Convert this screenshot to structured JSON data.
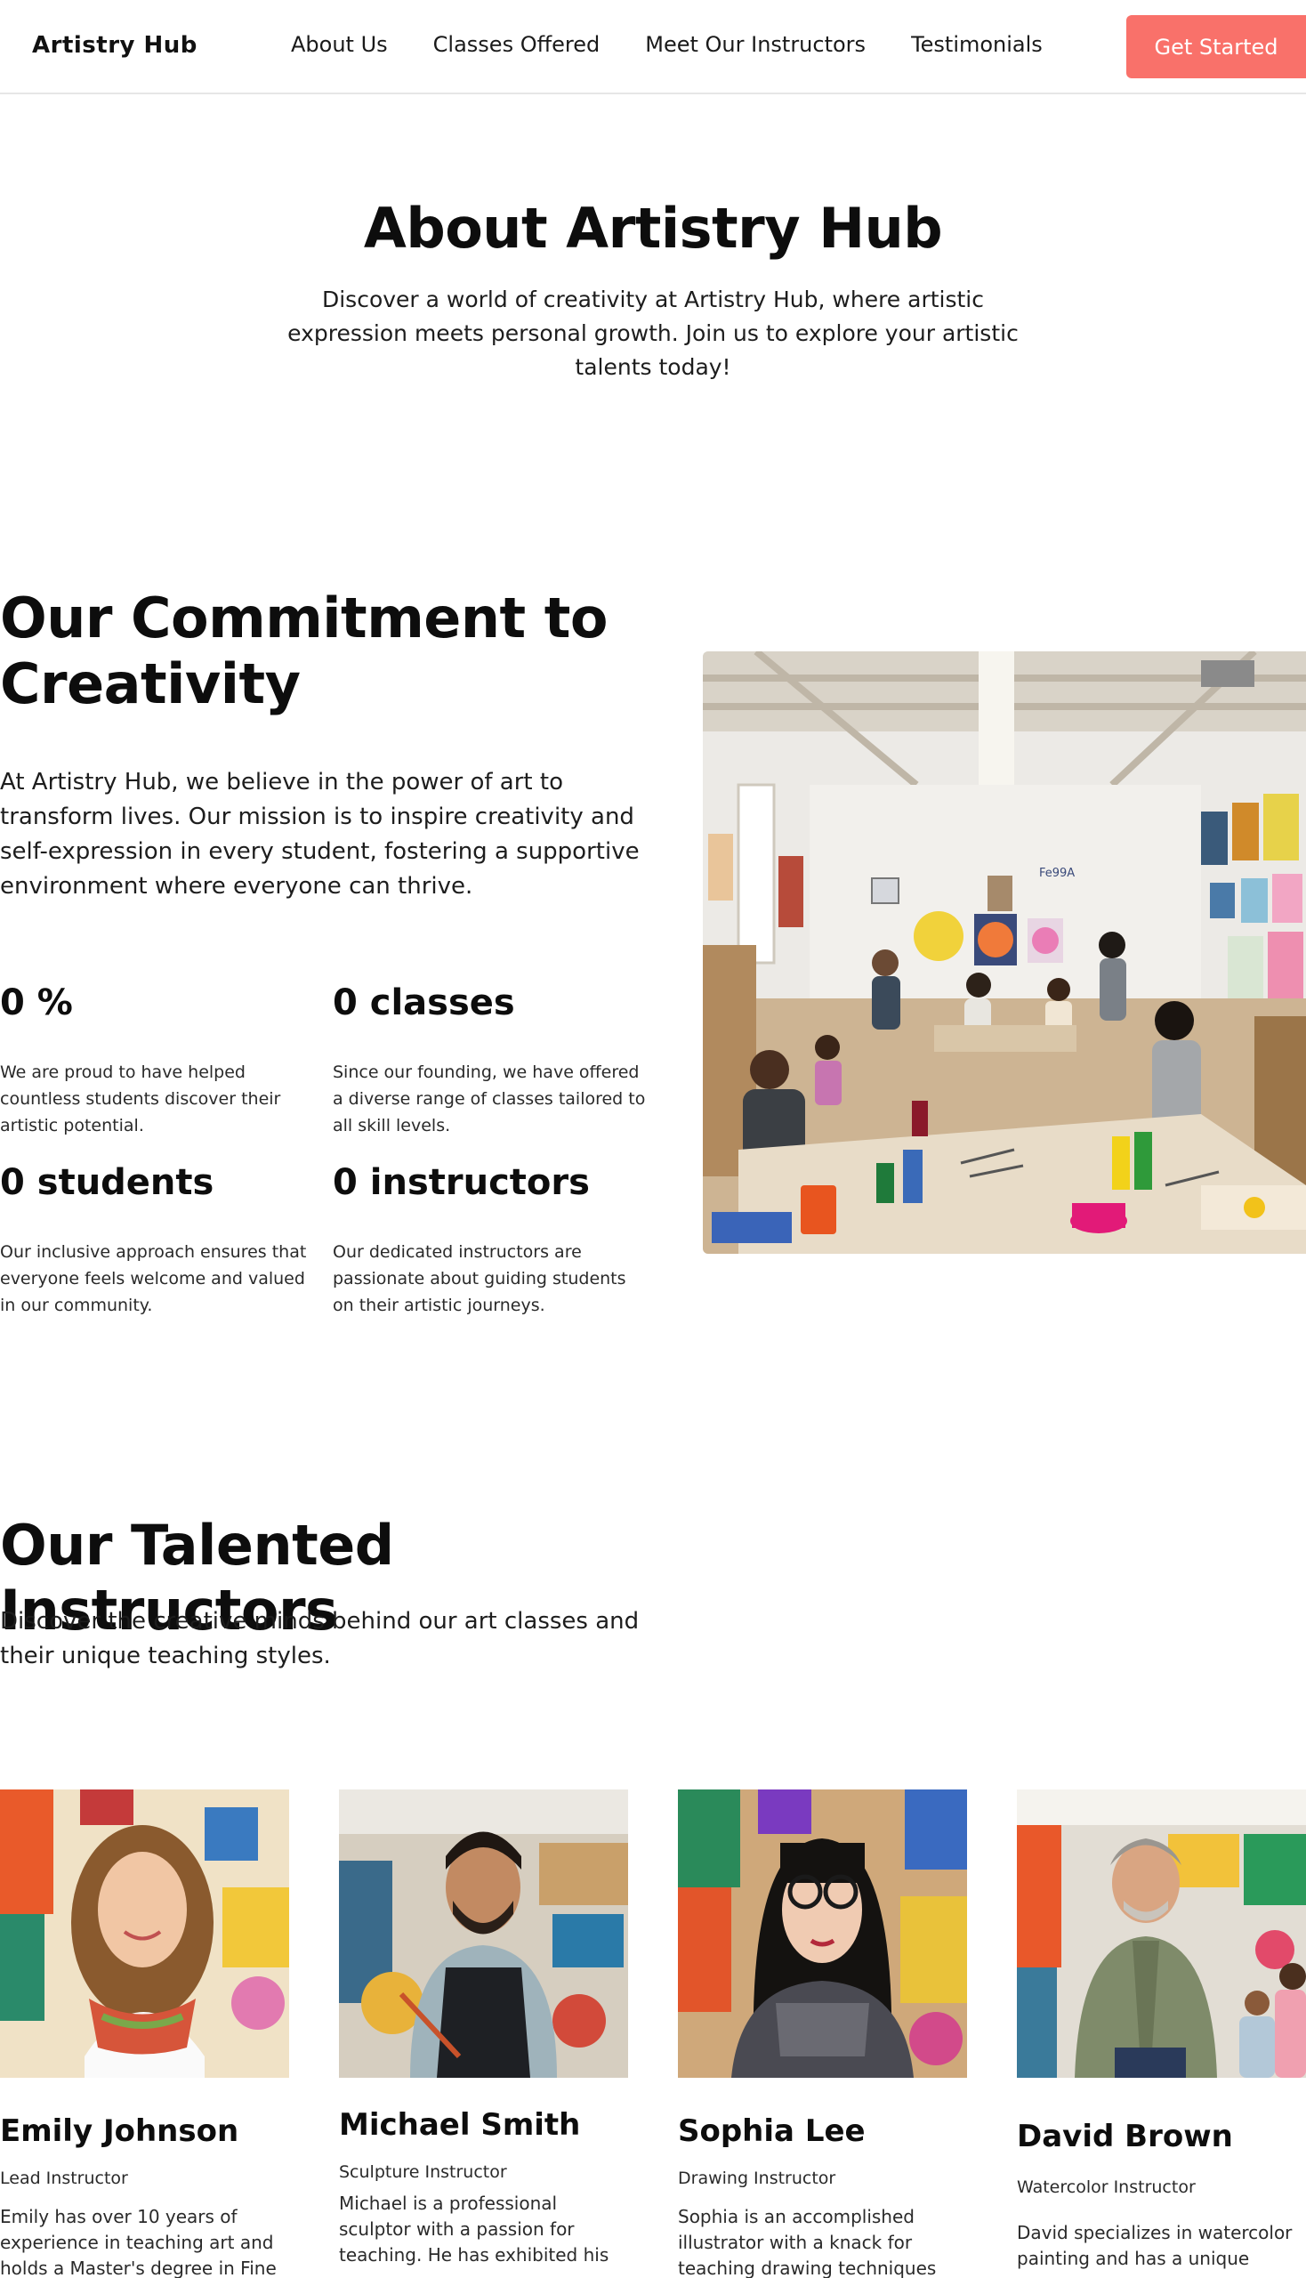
{
  "nav": {
    "logo": "Artistry Hub",
    "links": [
      "About Us",
      "Classes Offered",
      "Meet Our Instructors",
      "Testimonials"
    ],
    "cta_label": "Get Started"
  },
  "colors": {
    "accent": "#f9716a",
    "text": "#111111",
    "divider": "#e6e6e6"
  },
  "hero": {
    "title": "About Artistry Hub",
    "subtitle": "Discover a world of creativity at Artistry Hub, where artistic expression meets personal growth. Join us to explore your artistic talents today!"
  },
  "commitment": {
    "title": "Our Commitment to Creativity",
    "text": "At Artistry Hub, we believe in the power of art to transform lives. Our mission is to inspire creativity and self-expression in every student, fostering a supportive environment where everyone can thrive.",
    "stats": [
      {
        "value": "0 %",
        "desc": "We are proud to have helped countless students discover their artistic potential."
      },
      {
        "value": "0 classes",
        "desc": "Since our founding, we have offered a diverse range of classes tailored to all skill levels."
      },
      {
        "value": "0 students",
        "desc": "Our inclusive approach ensures that everyone feels welcome and valued in our community."
      },
      {
        "value": "0 instructors",
        "desc": "Our dedicated instructors are passionate about guiding students on their artistic journeys."
      }
    ],
    "image_board_text": "Fe99A"
  },
  "instructors": {
    "title": "Our Talented Instructors",
    "subtitle": "Discover the creative minds behind our art classes and their unique teaching styles.",
    "cards": [
      {
        "name": "Emily Johnson",
        "role": "Lead Instructor",
        "bio": "Emily has over 10 years of experience in teaching art and holds a Master's degree in Fine"
      },
      {
        "name": "Michael Smith",
        "role": "Sculpture Instructor",
        "bio": "Michael is a professional sculptor with a passion for teaching. He has exhibited his"
      },
      {
        "name": "Sophia Lee",
        "role": "Drawing Instructor",
        "bio": "Sophia is an accomplished illustrator with a knack for teaching drawing techniques"
      },
      {
        "name": "David Brown",
        "role": "Watercolor Instructor",
        "bio": "David specializes in watercolor painting and has a unique"
      }
    ]
  }
}
